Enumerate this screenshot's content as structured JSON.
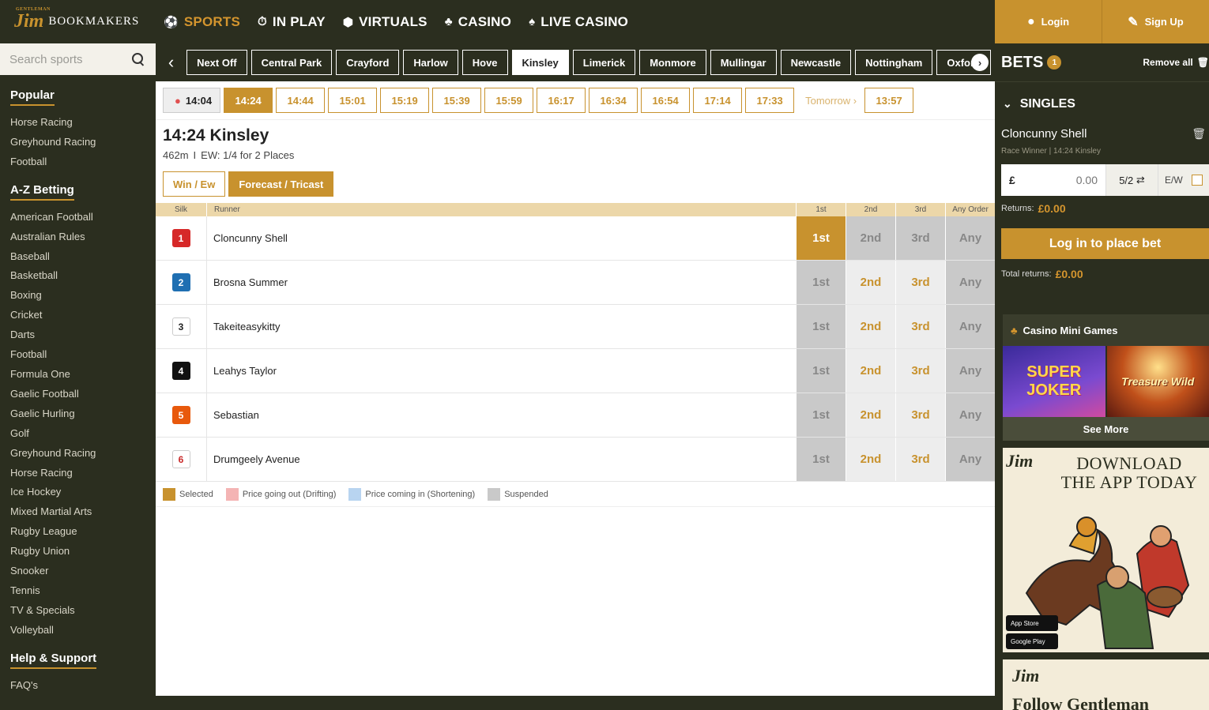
{
  "brand": {
    "small": "GENTLEMAN",
    "jim": "Jim",
    "name": "BOOKMAKERS"
  },
  "nav": [
    {
      "label": "SPORTS",
      "icon": "⚽",
      "active": true
    },
    {
      "label": "IN PLAY",
      "icon": "⏱",
      "active": false
    },
    {
      "label": "VIRTUALS",
      "icon": "⬢",
      "active": false
    },
    {
      "label": "CASINO",
      "icon": "♣",
      "active": false
    },
    {
      "label": "LIVE CASINO",
      "icon": "♠",
      "active": false
    }
  ],
  "search": {
    "placeholder": "Search sports"
  },
  "sidebar": {
    "popular_heading": "Popular",
    "popular": [
      "Horse Racing",
      "Greyhound Racing",
      "Football"
    ],
    "az_heading": "A-Z Betting",
    "az": [
      "American Football",
      "Australian Rules",
      "Baseball",
      "Basketball",
      "Boxing",
      "Cricket",
      "Darts",
      "Football",
      "Formula One",
      "Gaelic Football",
      "Gaelic Hurling",
      "Golf",
      "Greyhound Racing",
      "Horse Racing",
      "Ice Hockey",
      "Mixed Martial Arts",
      "Rugby League",
      "Rugby Union",
      "Snooker",
      "Tennis",
      "TV & Specials",
      "Volleyball"
    ],
    "help_heading": "Help & Support",
    "help": [
      "FAQ's"
    ]
  },
  "meetings": [
    {
      "label": "Next Off",
      "active": false
    },
    {
      "label": "Central Park",
      "active": false
    },
    {
      "label": "Crayford",
      "active": false
    },
    {
      "label": "Harlow",
      "active": false
    },
    {
      "label": "Hove",
      "active": false
    },
    {
      "label": "Kinsley",
      "active": true
    },
    {
      "label": "Limerick",
      "active": false
    },
    {
      "label": "Monmore",
      "active": false
    },
    {
      "label": "Mullingar",
      "active": false
    },
    {
      "label": "Newcastle",
      "active": false
    },
    {
      "label": "Nottingham",
      "active": false
    },
    {
      "label": "Oxford",
      "active": false
    }
  ],
  "times": {
    "current": "14:04",
    "slots": [
      {
        "label": "14:24",
        "active": true
      },
      {
        "label": "14:44",
        "active": false
      },
      {
        "label": "15:01",
        "active": false
      },
      {
        "label": "15:19",
        "active": false
      },
      {
        "label": "15:39",
        "active": false
      },
      {
        "label": "15:59",
        "active": false
      },
      {
        "label": "16:17",
        "active": false
      },
      {
        "label": "16:34",
        "active": false
      },
      {
        "label": "16:54",
        "active": false
      },
      {
        "label": "17:14",
        "active": false
      },
      {
        "label": "17:33",
        "active": false
      }
    ],
    "tomorrow_label": "Tomorrow",
    "tomorrow_slots": [
      "13:57"
    ]
  },
  "race": {
    "title": "14:24 Kinsley",
    "distance": "462m",
    "separator": "I",
    "ew_terms": "EW: 1/4 for 2 Places",
    "tabs": [
      {
        "label": "Win / Ew",
        "active": false
      },
      {
        "label": "Forecast / Tricast",
        "active": true
      }
    ]
  },
  "grid": {
    "headers": {
      "silk": "Silk",
      "runner": "Runner",
      "first": "1st",
      "second": "2nd",
      "third": "3rd",
      "any": "Any Order"
    },
    "runners": [
      {
        "trap": "1",
        "name": "Cloncunny Shell",
        "silk_bg": "#d62828",
        "silk_fg": "#ffffff",
        "states": [
          "selected",
          "disabled",
          "disabled",
          "disabled"
        ]
      },
      {
        "trap": "2",
        "name": "Brosna Summer",
        "silk_bg": "#1f6fb2",
        "silk_fg": "#ffffff",
        "states": [
          "disabled",
          "on",
          "on",
          "disabled"
        ]
      },
      {
        "trap": "3",
        "name": "Takeiteasykitty",
        "silk_bg": "#ffffff",
        "silk_fg": "#222222",
        "states": [
          "disabled",
          "on",
          "on",
          "disabled"
        ]
      },
      {
        "trap": "4",
        "name": "Leahys Taylor",
        "silk_bg": "#111111",
        "silk_fg": "#ffffff",
        "states": [
          "disabled",
          "on",
          "on",
          "disabled"
        ]
      },
      {
        "trap": "5",
        "name": "Sebastian",
        "silk_bg": "#e8590c",
        "silk_fg": "#ffffff",
        "states": [
          "disabled",
          "on",
          "on",
          "disabled"
        ]
      },
      {
        "trap": "6",
        "name": "Drumgeely Avenue",
        "silk_bg": "#ffffff",
        "silk_fg": "#c92a2a",
        "states": [
          "disabled",
          "on",
          "on",
          "disabled"
        ]
      }
    ],
    "button_labels": [
      "1st",
      "2nd",
      "3rd",
      "Any"
    ]
  },
  "legend": [
    {
      "label": "Selected",
      "color": "#c8922e"
    },
    {
      "label": "Price going out (Drifting)",
      "color": "#f4b4b4"
    },
    {
      "label": "Price coming in (Shortening)",
      "color": "#b8d4f0"
    },
    {
      "label": "Suspended",
      "color": "#c9c9c9"
    }
  ],
  "auth": {
    "login": "Login",
    "signup": "Sign Up"
  },
  "betslip": {
    "title": "BETS",
    "count": "1",
    "remove_all": "Remove all",
    "section": "SINGLES",
    "selection": "Cloncunny Shell",
    "meta": "Race Winner | 14:24 Kinsley",
    "currency": "£",
    "stake_placeholder": "0.00",
    "odds": "5/2",
    "ew_label": "E/W",
    "returns_label": "Returns:",
    "returns_value": "£0.00",
    "place_button": "Log in to place bet",
    "total_label": "Total returns:",
    "total_value": "£0.00"
  },
  "mini_games": {
    "title": "Casino Mini Games",
    "games": [
      "SUPER JOKER",
      "Treasure Wild"
    ],
    "see_more": "See More"
  },
  "promo": {
    "logo": "Jim",
    "title_line1": "DOWNLOAD",
    "title_line2": "THE APP TODAY",
    "app_store": "App Store",
    "google_play": "Google Play"
  },
  "promo2": {
    "logo": "Jim",
    "text": "Follow Gentleman"
  }
}
